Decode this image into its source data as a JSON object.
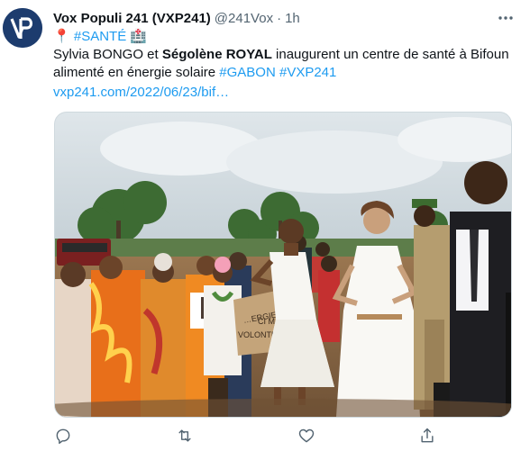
{
  "tweet": {
    "author_name": "Vox Populi 241 (VXP241)",
    "handle": "@241Vox",
    "separator": "·",
    "time": "1h",
    "line1": {
      "pin": "📍",
      "tag": "#SANTÉ",
      "hospital": "🏥"
    },
    "line2": {
      "t1": "Sylvia BONGO et ",
      "bold": "Ségolène ROYAL",
      "t2": " inaugurent un centre de santé à Bifoun"
    },
    "line3": {
      "t1": "alimenté en énergie solaire ",
      "tag1": "#GABON",
      "sp": " ",
      "tag2": "#VXP241"
    },
    "link": "vxp241.com/2022/06/23/bif…",
    "banner_text": {
      "a": "…ERGIE",
      "b": "CI M",
      "c": "VOLONTE"
    }
  },
  "icons": {
    "avatar": "vp-logo-icon",
    "more": "more-horizontal-icon",
    "reply": "reply-icon",
    "retweet": "retweet-icon",
    "like": "heart-icon",
    "share": "share-icon"
  },
  "colors": {
    "link": "#1d9bf0",
    "text": "#0f1419",
    "muted": "#536471",
    "avatar_bg": "#1d3c6e"
  }
}
